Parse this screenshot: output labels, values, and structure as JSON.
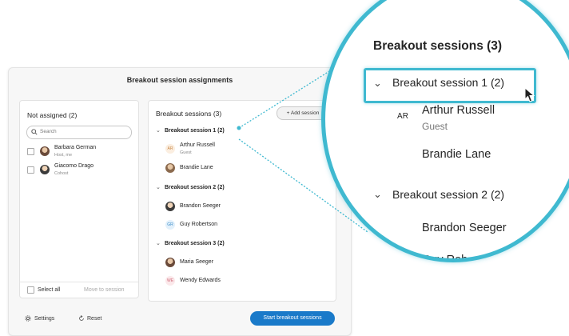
{
  "panel": {
    "title": "Breakout session assignments",
    "not_assigned": {
      "title": "Not assigned (2)",
      "search_placeholder": "Search",
      "people": [
        {
          "name": "Barbara German",
          "role": "Host, me"
        },
        {
          "name": "Giacomo Drago",
          "role": "Cohost"
        }
      ],
      "select_all": "Select all",
      "move_to_session": "Move to session"
    },
    "breakout": {
      "title": "Breakout sessions (3)",
      "add_session": "+ Add session",
      "sessions": [
        {
          "name": "Breakout session 1 (2)",
          "people": [
            {
              "name": "Arthur Russell",
              "role": "Guest",
              "initials": "AR"
            },
            {
              "name": "Brandie Lane",
              "role": ""
            }
          ]
        },
        {
          "name": "Breakout session 2 (2)",
          "people": [
            {
              "name": "Brandon Seeger",
              "role": ""
            },
            {
              "name": "Guy Robertson",
              "role": "",
              "initials": "GR"
            }
          ]
        },
        {
          "name": "Breakout session 3 (2)",
          "people": [
            {
              "name": "Maria Seeger",
              "role": ""
            },
            {
              "name": "Wendy Edwards",
              "role": "",
              "initials": "WE"
            }
          ]
        }
      ]
    },
    "footer": {
      "settings": "Settings",
      "reset": "Reset",
      "start": "Start breakout sessions"
    }
  },
  "zoom": {
    "title": "Breakout sessions (3)",
    "session1": "Breakout session 1 (2)",
    "person1": "Arthur Russell",
    "person1_role": "Guest",
    "person1_initials": "AR",
    "person2": "Brandie Lane",
    "session2": "Breakout session 2 (2)",
    "person3": "Brandon Seeger",
    "person4_partial": "Guy Rob"
  },
  "colors": {
    "accent": "#3fb9d0",
    "primary_button": "#1a7ac9"
  }
}
